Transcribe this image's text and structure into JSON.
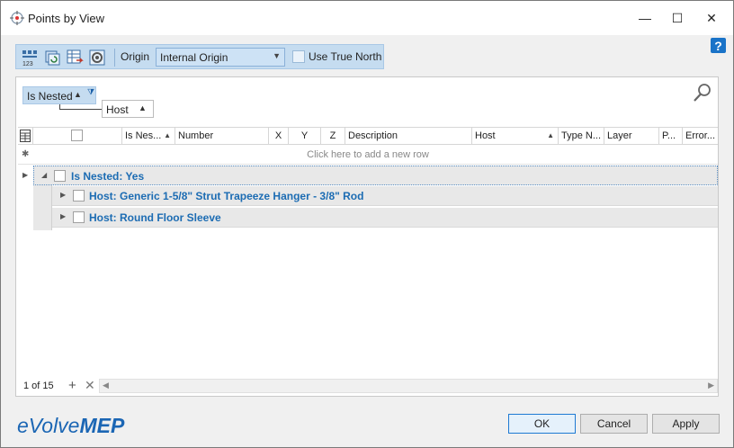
{
  "window": {
    "title": "Points by View",
    "minimize": "—",
    "maximize": "☐",
    "close": "✕"
  },
  "help_label": "?",
  "toolbar": {
    "origin_label": "Origin",
    "origin_value": "Internal Origin",
    "true_north_label": "Use True North",
    "true_north_checked": false,
    "icons": [
      "numbering-icon",
      "refresh-views-icon",
      "export-table-icon",
      "settings-gear-icon"
    ]
  },
  "group_panel": {
    "chip1": "Is Nested",
    "chip2": "Host"
  },
  "grid": {
    "columns": [
      "Is Nes...",
      "Number",
      "X",
      "Y",
      "Z",
      "Description",
      "Host",
      "Type N...",
      "Layer",
      "P...",
      "Error..."
    ],
    "new_row_text": "Click here to add a new row",
    "groups": [
      {
        "label": "Is Nested: Yes",
        "level": 0
      },
      {
        "label": "Host: Generic 1-5/8\" Strut Trapeeze Hanger - 3/8\" Rod",
        "level": 1
      },
      {
        "label": "Host: Round Floor Sleeve",
        "level": 1
      }
    ]
  },
  "footer": {
    "record_count": "1 of 15"
  },
  "brand": {
    "e": "e",
    "volve": "Volve",
    "mep": "MEP"
  },
  "buttons": {
    "ok": "OK",
    "cancel": "Cancel",
    "apply": "Apply"
  },
  "colors": {
    "accent": "#1c6cb3",
    "toolbar_bg": "#c5dcf0"
  }
}
